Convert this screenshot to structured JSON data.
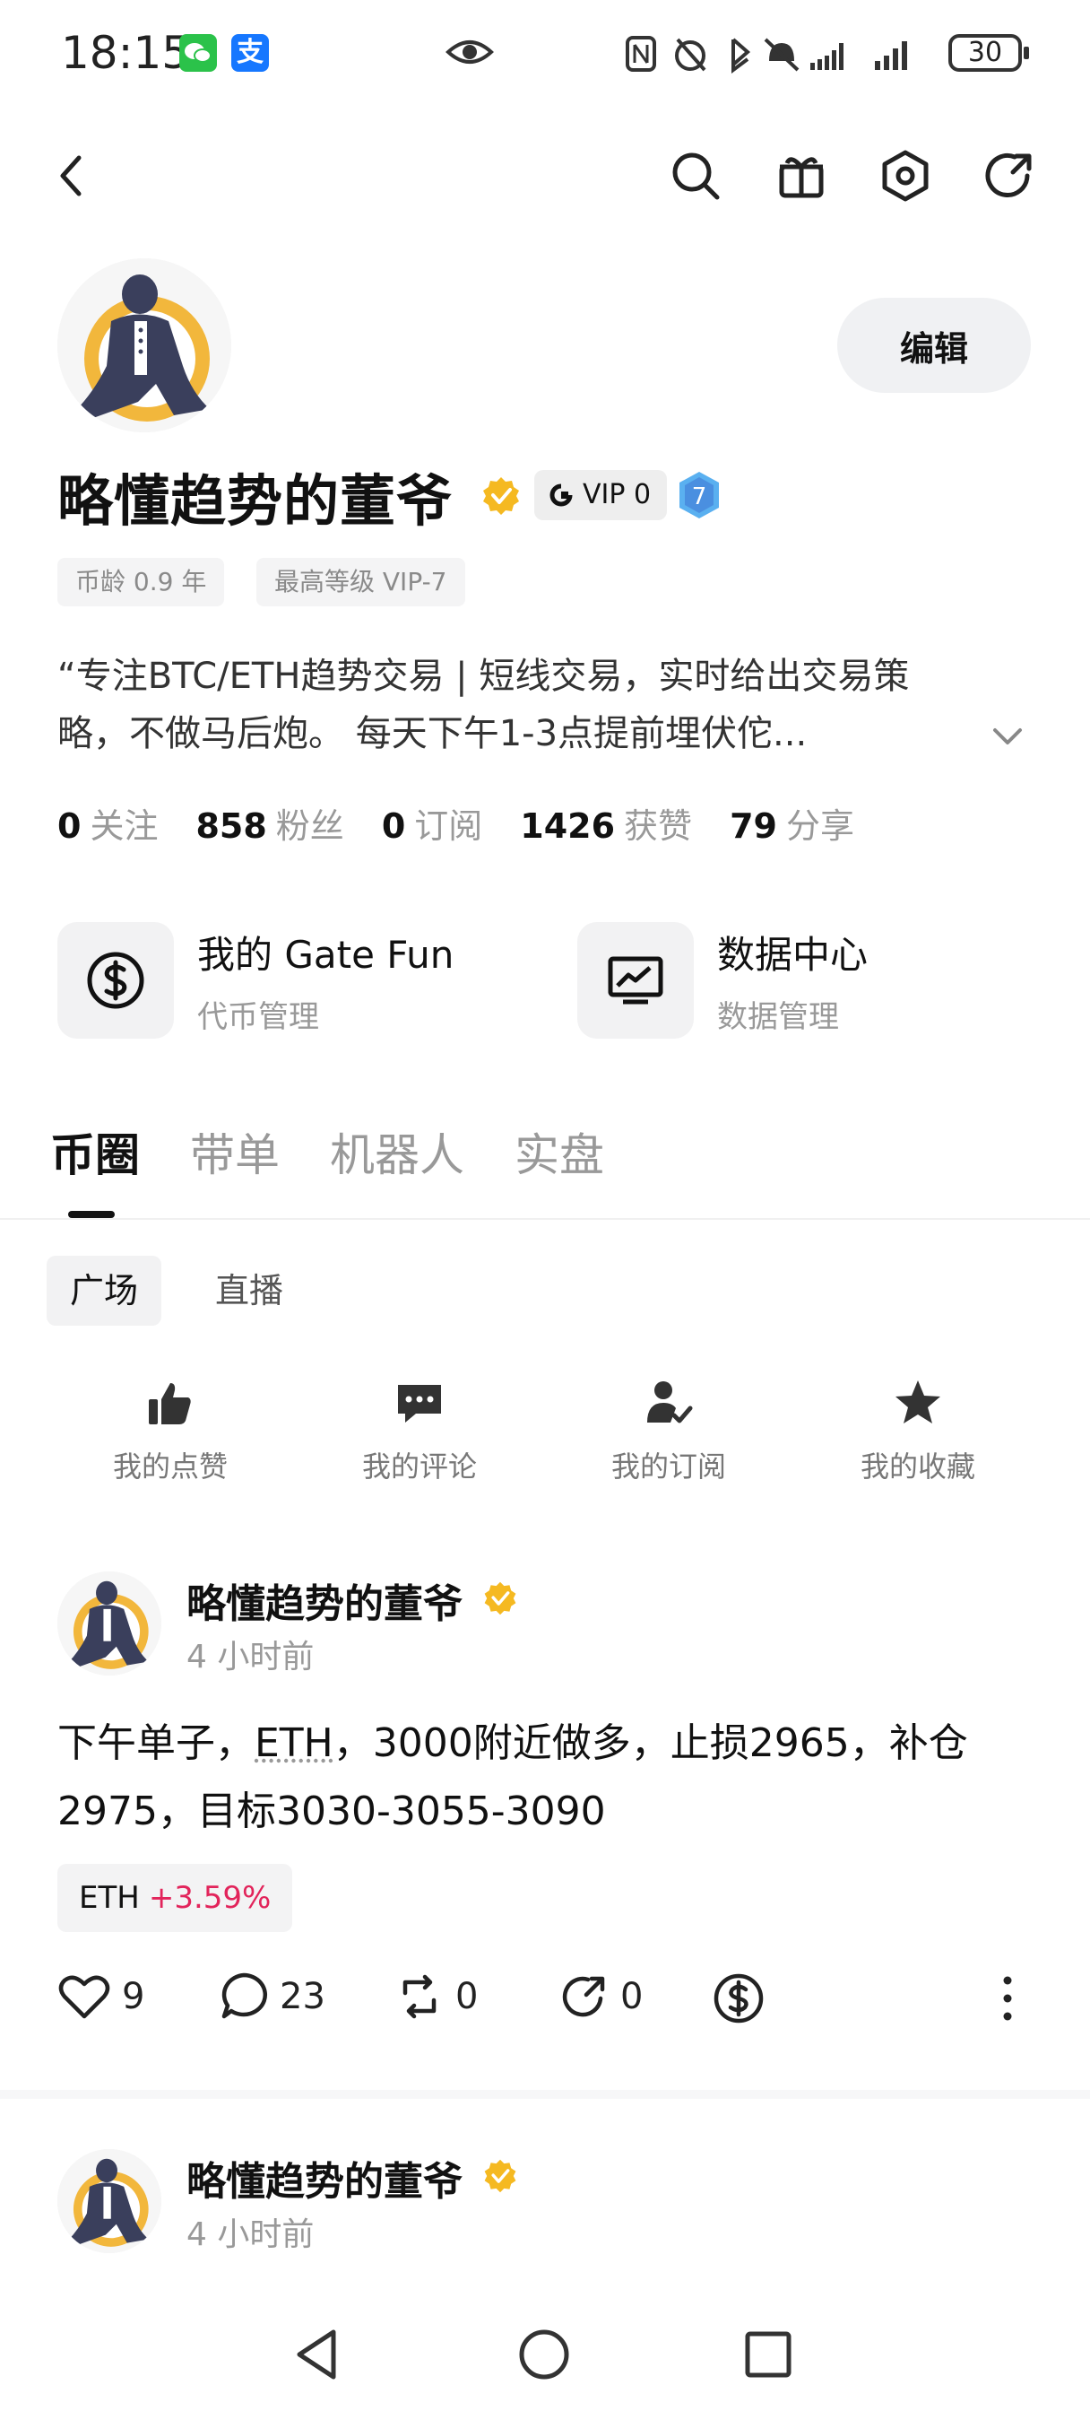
{
  "status_bar": {
    "time": "18:15",
    "alipay_glyph": "支",
    "battery": "30"
  },
  "profile": {
    "name": "略懂趋势的董爷",
    "vip": "VIP 0",
    "level": "7",
    "tags": [
      "币龄 0.9 年",
      "最高等级 VIP-7"
    ],
    "edit_label": "编辑",
    "bio_line1": "“专注BTC/ETH趋势交易 | 短线交易，实时给出交易策",
    "bio_line2": "略，不做马后炮。 每天下午1-3点提前埋伏佗...",
    "stats": [
      {
        "value": "0",
        "label": "关注"
      },
      {
        "value": "858",
        "label": "粉丝"
      },
      {
        "value": "0",
        "label": "订阅"
      },
      {
        "value": "1426",
        "label": "获赞"
      },
      {
        "value": "79",
        "label": "分享"
      }
    ]
  },
  "tools": [
    {
      "title": "我的 Gate Fun",
      "subtitle": "代币管理",
      "icon": "dollar-circle-icon"
    },
    {
      "title": "数据中心",
      "subtitle": "数据管理",
      "icon": "chart-monitor-icon"
    }
  ],
  "tabs": [
    "币圈",
    "带单",
    "机器人",
    "实盘"
  ],
  "subtabs": [
    "广场",
    "直播"
  ],
  "quick_actions": [
    "我的点赞",
    "我的评论",
    "我的订阅",
    "我的收藏"
  ],
  "posts": [
    {
      "author": "略懂趋势的董爷",
      "time": "4 小时前",
      "text_before": "下午单子，",
      "text_coin": "ETH",
      "text_after": "，3000附近做多，止损2965，补仓2975，目标3030-3055-3090",
      "coin": "ETH",
      "change": "+3.59%",
      "likes": "9",
      "comments": "23",
      "reposts": "0",
      "shares": "0"
    },
    {
      "author": "略懂趋势的董爷",
      "time": "4 小时前"
    }
  ],
  "colors": {
    "accent_red": "#e2245b",
    "badge_gold": "#f5b921",
    "level_blue": "#5ab0f0"
  }
}
